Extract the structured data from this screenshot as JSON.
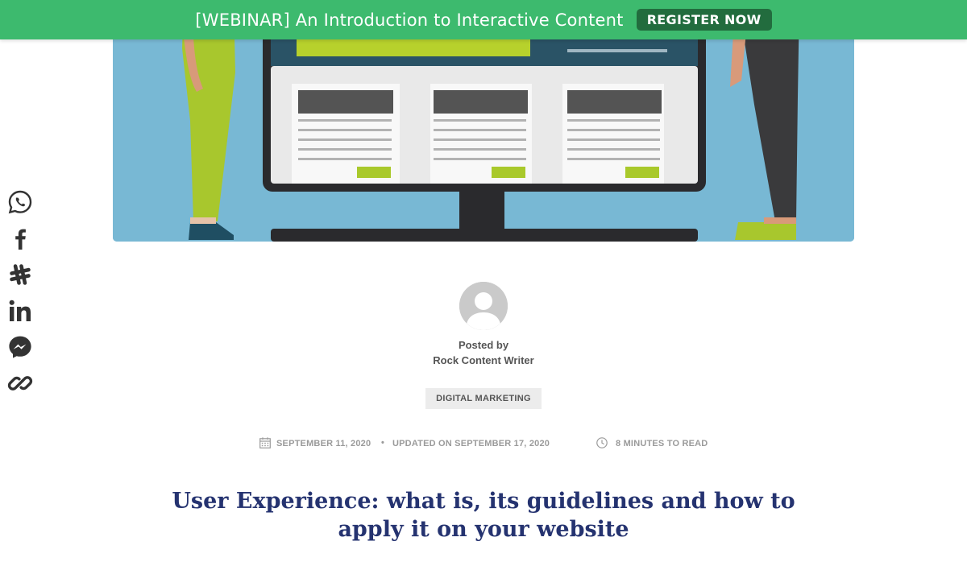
{
  "banner": {
    "text": "[WEBINAR] An Introduction to Interactive Content",
    "button_label": "REGISTER NOW",
    "background_color": "#3dba6e",
    "button_color": "#226c3e"
  },
  "hero": {
    "image": "illustration of computer monitor with content cards and two people standing"
  },
  "share": {
    "icons": [
      "whatsapp-icon",
      "facebook-icon",
      "slack-icon",
      "linkedin-icon",
      "messenger-icon",
      "link-icon"
    ]
  },
  "author": {
    "posted_by": "Posted by",
    "name": "Rock Content Writer"
  },
  "category": "DIGITAL MARKETING",
  "meta": {
    "date": "SEPTEMBER 11, 2020",
    "separator": "•",
    "updated": "UPDATED ON SEPTEMBER 17, 2020",
    "read_time": "8 MINUTES TO READ"
  },
  "article": {
    "title": "User Experience: what is, its guidelines and how to apply it on your website",
    "title_color": "#253370"
  }
}
